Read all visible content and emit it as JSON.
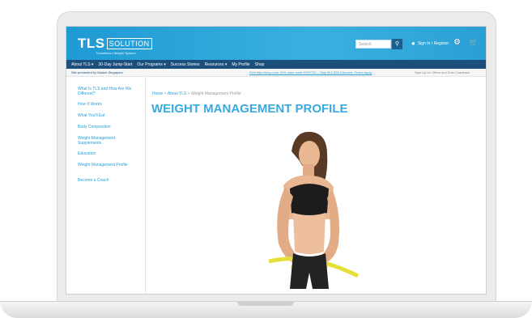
{
  "header": {
    "logo_main": "TLS",
    "logo_box": "SOLUTION",
    "logo_tag": "Transitions Lifestyle System",
    "search_placeholder": "Search",
    "signin": "Sign In / Register"
  },
  "nav": [
    "About TLS ▾",
    "30-Day Jump-Start",
    "Our Programs ▾",
    "Success Stories",
    "Resources ▾",
    "My Profile",
    "Shop"
  ],
  "subbar": {
    "left": "Site presented by Market Singapore",
    "middle": "Find http://shop.com 30% order code FIRST30 – Ship $12 $25 Discount. Terms Apply",
    "right": "Sign Up for Offers and Earn Cashback"
  },
  "sidebar": {
    "items": [
      "What Is TLS and How Are We Different?",
      "How It Works",
      "What You'll Eat",
      "Body Composition",
      "Weight Management Supplements",
      "Education",
      "Weight Management Profile",
      "Become a Coach"
    ]
  },
  "breadcrumb": {
    "home": "Home",
    "sep": ">",
    "about": "About TLS",
    "current": "Weight Management Profile"
  },
  "page": {
    "title": "WEIGHT MANAGEMENT PROFILE"
  },
  "icons": [
    "search-icon",
    "user-icon",
    "gear-icon",
    "cart-icon"
  ],
  "colors": {
    "brand_blue": "#2a9fd6",
    "nav_dark": "#1d4f7d",
    "title_blue": "#39aadf"
  }
}
